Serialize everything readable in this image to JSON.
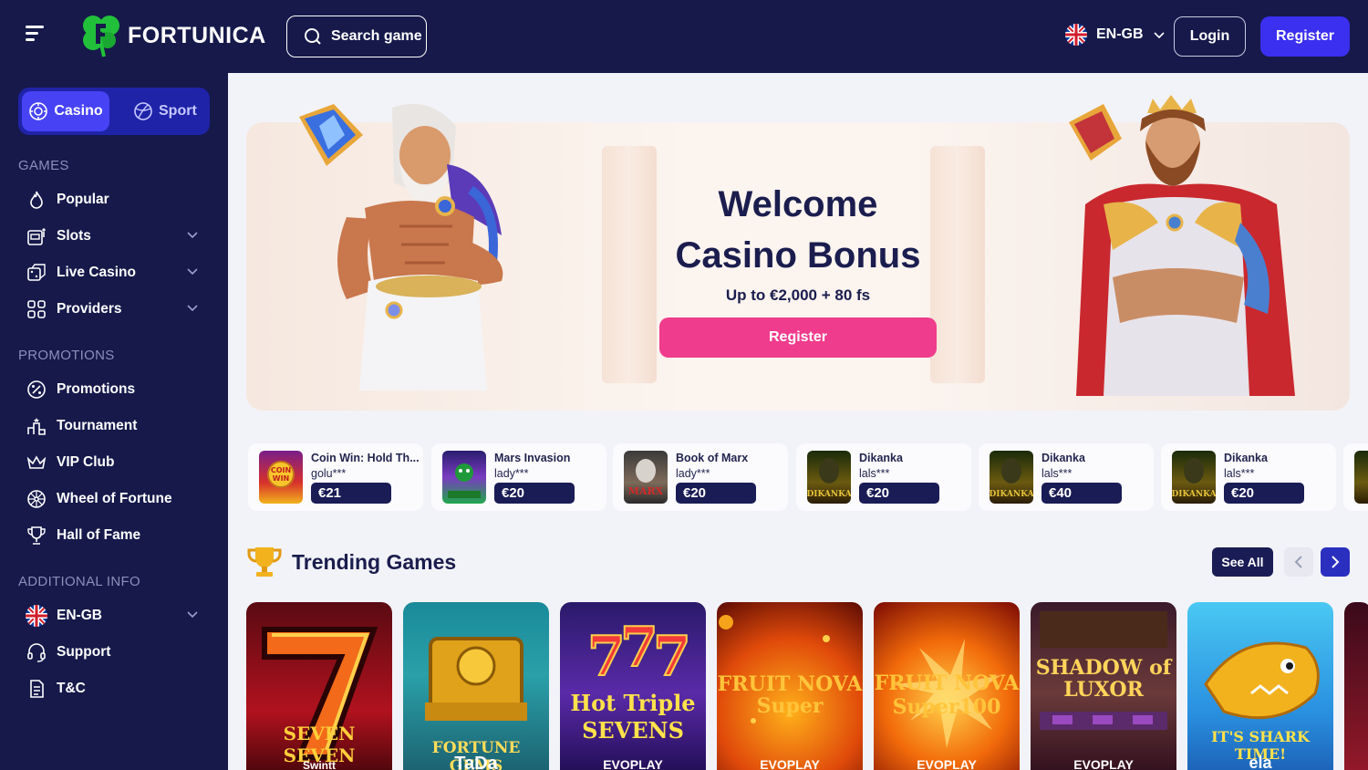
{
  "header": {
    "brand": "FORTUNICA",
    "search_label": "Search game",
    "language": "EN-GB",
    "login_label": "Login",
    "register_label": "Register"
  },
  "sidebar": {
    "switch": {
      "casino": "Casino",
      "sport": "Sport"
    },
    "sections": {
      "games": "GAMES",
      "promotions": "PROMOTIONS",
      "additional": "ADDITIONAL INFO"
    },
    "games_items": [
      {
        "label": "Popular",
        "icon": "flame-icon"
      },
      {
        "label": "Slots",
        "icon": "slot-machine-icon"
      },
      {
        "label": "Live Casino",
        "icon": "dice-icon"
      },
      {
        "label": "Providers",
        "icon": "grid-icon"
      }
    ],
    "promo_items": [
      {
        "label": "Promotions",
        "icon": "percent-icon"
      },
      {
        "label": "Tournament",
        "icon": "podium-icon"
      },
      {
        "label": "VIP Club",
        "icon": "crown-icon"
      },
      {
        "label": "Wheel of Fortune",
        "icon": "wheel-icon"
      },
      {
        "label": "Hall of Fame",
        "icon": "trophy-icon"
      }
    ],
    "info_items": [
      {
        "label": "EN-GB",
        "icon": "uk-flag-icon"
      },
      {
        "label": "Support",
        "icon": "headset-icon"
      },
      {
        "label": "T&C",
        "icon": "document-icon"
      }
    ]
  },
  "hero": {
    "title_line1": "Welcome",
    "title_line2": "Casino Bonus",
    "subtitle": "Up to €2,000 + 80 fs",
    "button": "Register"
  },
  "winners": [
    {
      "game": "Coin Win: Hold Th...",
      "user": "golu***",
      "amount": "€21"
    },
    {
      "game": "Mars Invasion",
      "user": "lady***",
      "amount": "€20"
    },
    {
      "game": "Book of Marx",
      "user": "lady***",
      "amount": "€20"
    },
    {
      "game": "Dikanka",
      "user": "lals***",
      "amount": "€20"
    },
    {
      "game": "Dikanka",
      "user": "lals***",
      "amount": "€40"
    },
    {
      "game": "Dikanka",
      "user": "lals***",
      "amount": "€20"
    }
  ],
  "trending": {
    "title": "Trending Games",
    "see_all": "See All"
  },
  "games": [
    {
      "name": "SEVEN SEVEN",
      "provider": "Swintt"
    },
    {
      "name": "FORTUNE GEMS",
      "provider": "TaDa"
    },
    {
      "name": "Hot Triple SEVENS",
      "provider": "EVOPLAY"
    },
    {
      "name": "FRUIT NOVA Super",
      "provider": "EVOPLAY"
    },
    {
      "name": "FRUIT NOVA Super100",
      "provider": "EVOPLAY"
    },
    {
      "name": "SHADOW of LUXOR",
      "provider": "EVOPLAY"
    },
    {
      "name": "IT'S SHARK TIME!",
      "provider": "ela"
    }
  ],
  "colors": {
    "navy": "#16194a",
    "accent_blue": "#3b2ff0",
    "pink": "#f03c8c",
    "logo_green": "#22c03a"
  }
}
